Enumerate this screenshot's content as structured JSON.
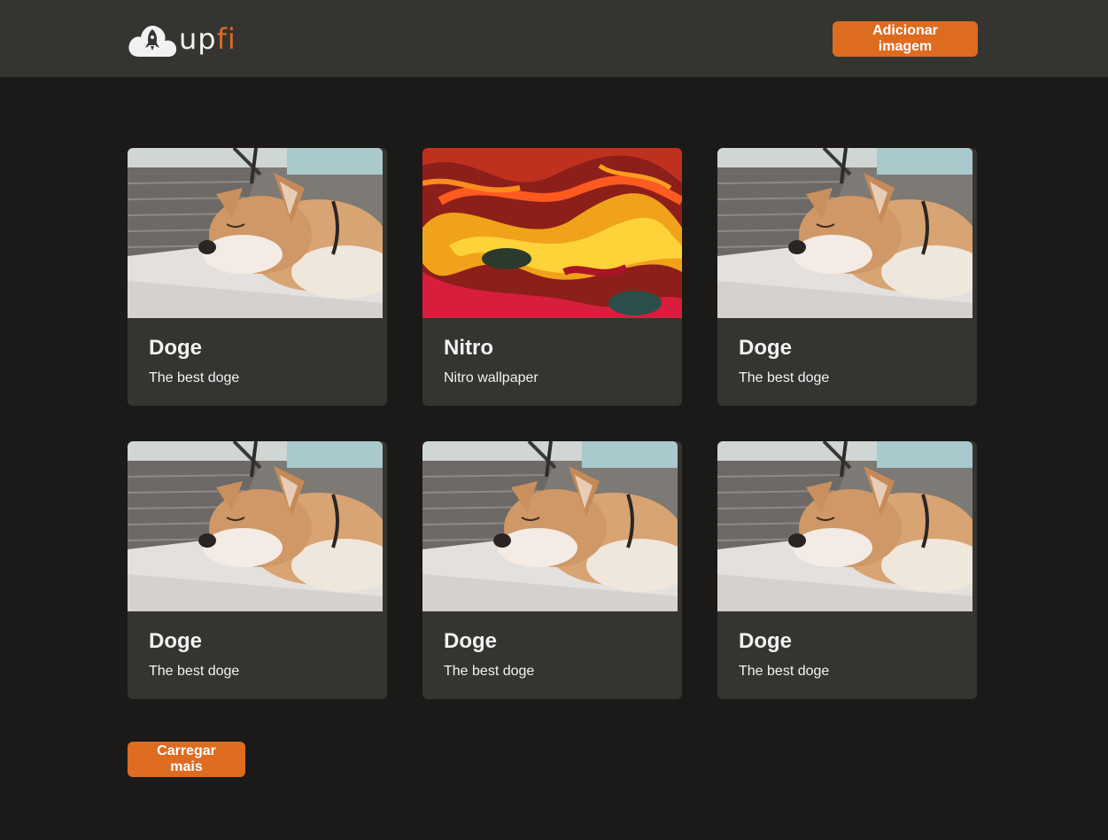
{
  "header": {
    "logo_text_a": "up",
    "logo_text_b": "fi",
    "add_button": "Adicionar imagem"
  },
  "cards": [
    {
      "title": "Doge",
      "description": "The best doge",
      "image": "shiba-dog"
    },
    {
      "title": "Nitro",
      "description": "Nitro wallpaper",
      "image": "abstract-fire"
    },
    {
      "title": "Doge",
      "description": "The best doge",
      "image": "shiba-dog"
    },
    {
      "title": "Doge",
      "description": "The best doge",
      "image": "shiba-dog"
    },
    {
      "title": "Doge",
      "description": "The best doge",
      "image": "shiba-dog"
    },
    {
      "title": "Doge",
      "description": "The best doge",
      "image": "shiba-dog"
    }
  ],
  "load_more_button": "Carregar mais",
  "colors": {
    "accent": "#dd6b20",
    "header_bg": "#353431",
    "page_bg": "#1b1a19",
    "card_bg": "#353431",
    "text": "#f3f2f2"
  }
}
